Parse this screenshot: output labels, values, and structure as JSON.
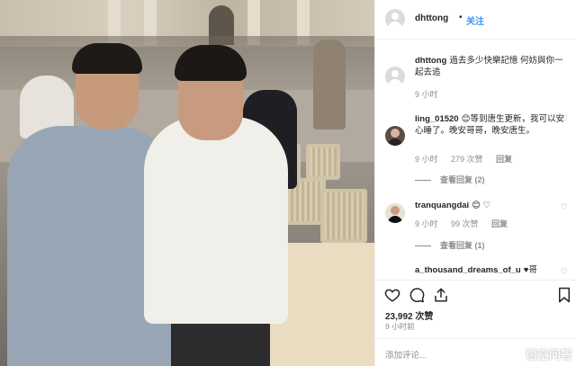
{
  "post": {
    "username": "dhttong",
    "separator": "•",
    "follow_label": "关注",
    "caption": {
      "username": "dhttong",
      "text": "過去多少快樂記憶 何妨與你一起去追",
      "time": "9 小时"
    }
  },
  "comments": [
    {
      "username": "ling_01520",
      "text": "😊等到唐生更新，我可以安心睡了。晚安哥哥，晚安唐生。",
      "time": "9 小时",
      "likes": "279 次赞",
      "reply_label": "回复",
      "view_replies": "查看回复 (2)"
    },
    {
      "username": "tranquangdai",
      "text": "😊 ♡",
      "time": "9 小时",
      "likes": "99 次赞",
      "reply_label": "回复",
      "view_replies": "查看回复 (1)"
    },
    {
      "username": "a_thousand_dreams_of_u",
      "text": "♥哥",
      "time": "",
      "likes": "",
      "reply_label": "",
      "view_replies": ""
    }
  ],
  "actions": {
    "like_icon": "heart-icon",
    "comment_icon": "comment-icon",
    "share_icon": "share-icon",
    "save_icon": "bookmark-icon",
    "likes_count": "23,992 次赞",
    "time_ago": "9 小时前",
    "add_comment_placeholder": "添加评论..."
  },
  "watermark": "悟空问答",
  "colors": {
    "follow_blue": "#3897f0",
    "muted_gray": "#8e8e8e",
    "text": "#262626",
    "border": "#efefef"
  }
}
